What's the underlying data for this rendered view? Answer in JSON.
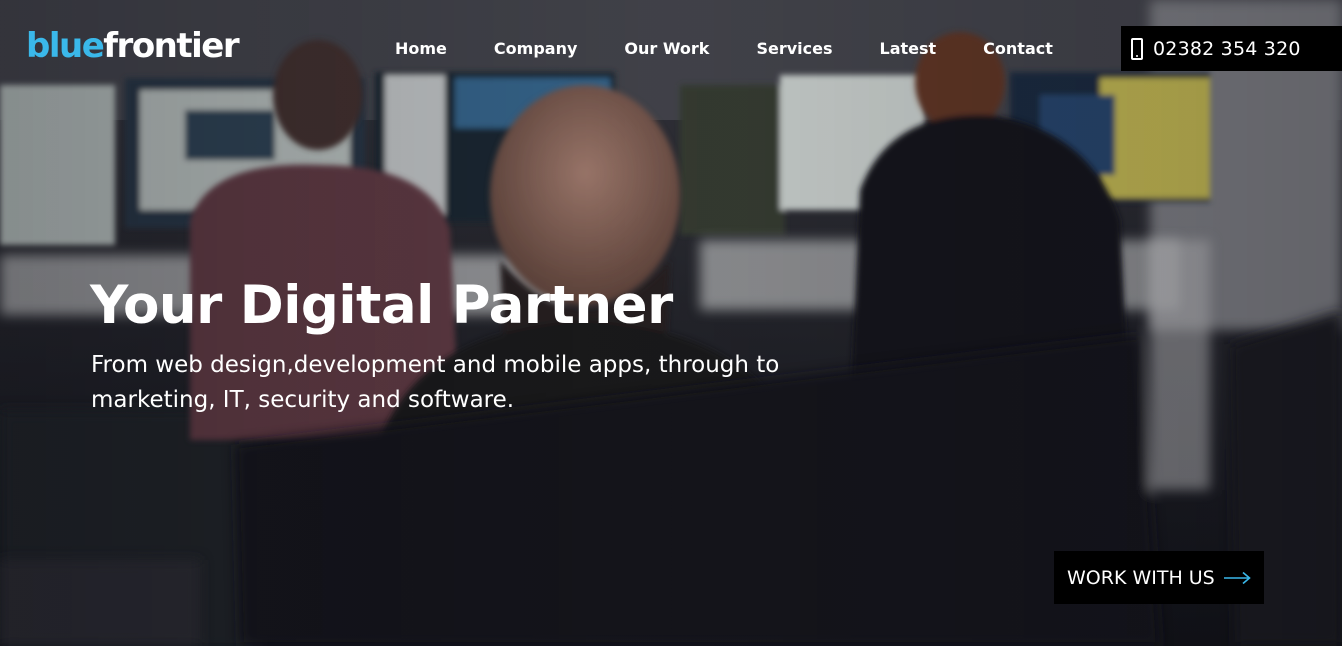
{
  "brand": {
    "logo_part1": "blue",
    "logo_part2": "frontier",
    "accent_color": "#3ab8ea"
  },
  "nav": {
    "items": [
      {
        "label": "Home"
      },
      {
        "label": "Company"
      },
      {
        "label": "Our Work"
      },
      {
        "label": "Services"
      },
      {
        "label": "Latest"
      },
      {
        "label": "Contact"
      }
    ]
  },
  "contact": {
    "phone_icon": "mobile-phone-icon",
    "phone_number": "02382 354 320"
  },
  "hero": {
    "background": "office-photo",
    "headline": "Your Digital Partner",
    "subline": "From web design,development and mobile apps, through to marketing, IT, security and software.",
    "cta_label": "WORK WITH US",
    "cta_icon": "arrow-right-icon"
  }
}
